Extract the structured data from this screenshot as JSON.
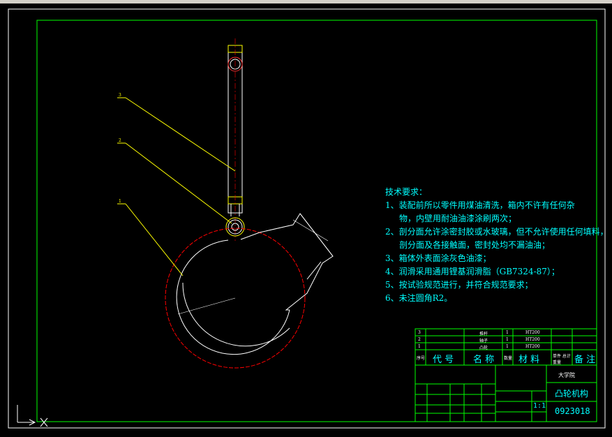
{
  "notes": {
    "title": "技术要求：",
    "lines": [
      "1、装配前所以零件用煤油清洗，箱内不许有任何杂",
      "物，内壁用耐油油漆涂刷两次；",
      "2、剖分面允许涂密封胶或水玻璃，但不允许使用任何填料，",
      "剖分面及各接触面，密封处均不漏油油；",
      "3、箱体外表面涂灰色油漆；",
      "4、润滑采用通用锂基润滑脂（GB7324-87）；",
      "5、按试验规范进行，并符合规范要求；",
      "6、未注圆角R2。"
    ]
  },
  "parts_list": {
    "rows": [
      {
        "no": "3",
        "name": "推杆",
        "qty": "1",
        "material": "HT200"
      },
      {
        "no": "2",
        "name": "轴子",
        "qty": "1",
        "material": "HT200"
      },
      {
        "no": "1",
        "name": "凸轮",
        "qty": "1",
        "material": "HT200"
      }
    ],
    "headers": {
      "seq": "序号",
      "code": "代 号",
      "name": "名 称",
      "qty": "数量",
      "material": "材 料",
      "weight": "单件 总计 重量",
      "remark": "备 注"
    }
  },
  "title_block": {
    "school": "大学院",
    "drawing_name": "凸轮机构",
    "scale": "1:1",
    "drawing_no": "0923018"
  },
  "balloons": [
    "3",
    "2",
    "1"
  ],
  "colors": {
    "frame": "#00ff00",
    "drawing": "#ffffff",
    "annotation": "#ffff00",
    "text": "#00ffff",
    "center_line": "#ff0000"
  }
}
